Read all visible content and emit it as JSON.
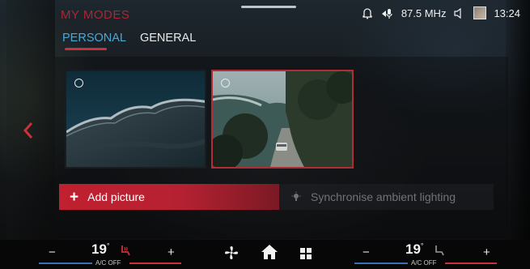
{
  "header": {
    "title": "MY MODES",
    "tabs": [
      {
        "label": "PERSONAL",
        "active": true
      },
      {
        "label": "GENERAL",
        "active": false
      }
    ]
  },
  "status_bar": {
    "radio_frequency": "87.5 MHz",
    "time": "13:24",
    "icons": [
      "notification-bell-icon",
      "microphone-signal-icon",
      "speaker-icon",
      "profile-thumbnail"
    ]
  },
  "cards": [
    {
      "name": "aerial-coast-picture",
      "selected": false
    },
    {
      "name": "coastal-road-picture",
      "selected": true
    }
  ],
  "actions": {
    "add_picture": "Add picture",
    "synchronise": "Synchronise ambient lighting"
  },
  "climate": {
    "left": {
      "minus": "−",
      "temp": "19",
      "degree": "°",
      "ac": "A/C OFF",
      "plus": "+"
    },
    "right": {
      "minus": "−",
      "temp": "19",
      "degree": "°",
      "ac": "A/C OFF",
      "plus": "+"
    }
  },
  "colors": {
    "accent_red": "#c8323a",
    "active_tab_blue": "#4aa8d8",
    "bar_blue": "#3a6fb5"
  }
}
